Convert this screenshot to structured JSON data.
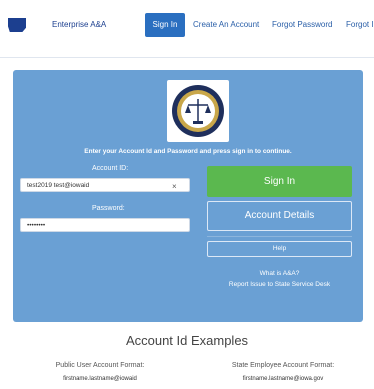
{
  "header": {
    "brand": "Enterprise A&A",
    "nav": {
      "sign_in": "Sign In",
      "create_account": "Create An Account",
      "forgot_password": "Forgot Password",
      "forgot_id": "Forgot I"
    }
  },
  "panel": {
    "instruction": "Enter your Account Id and Password and press sign in to continue.",
    "account_id_label": "Account ID:",
    "account_id_value": "test2019 test@iowaid",
    "password_label": "Password:",
    "password_value": "••••••••",
    "sign_in_button": "Sign In",
    "account_details_button": "Account Details",
    "help_button": "Help",
    "what_is_link": "What is A&A?",
    "report_link": "Report Issue to State Service Desk"
  },
  "examples": {
    "title": "Account Id Examples",
    "public_label": "Public User Account Format:",
    "public_value": "firstname.lastname@iowaid",
    "state_label": "State Employee Account Format:",
    "state_value": "firstname.lastname@iowa.gov"
  },
  "colors": {
    "panel": "#6aa0d4",
    "sign_in": "#5bb84f",
    "nav_active": "#2a6fc0"
  }
}
